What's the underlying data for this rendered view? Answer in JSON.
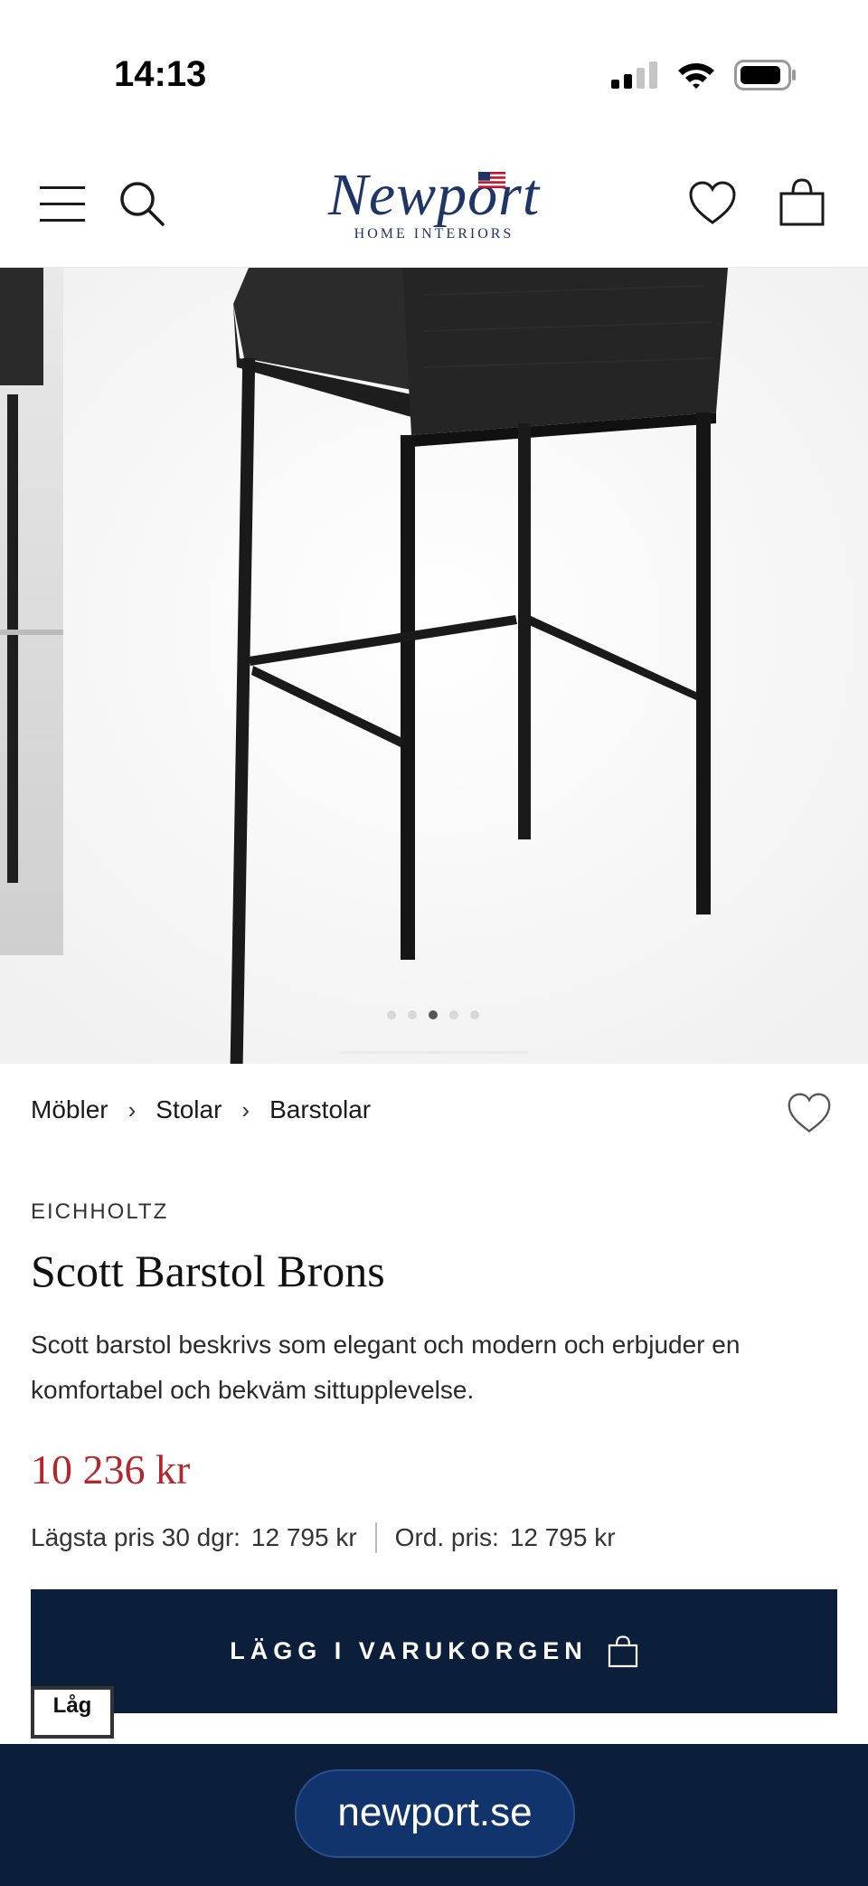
{
  "status_bar": {
    "time": "14:13"
  },
  "header": {
    "logo_word": "Newport",
    "logo_sub": "HOME INTERIORS"
  },
  "gallery": {
    "slide_count": 5,
    "active_index": 2
  },
  "breadcrumb": [
    "Möbler",
    "Stolar",
    "Barstolar"
  ],
  "breadcrumb_separator": "›",
  "product": {
    "brand": "EICHHOLTZ",
    "title": "Scott Barstol Brons",
    "description": "Scott barstol beskrivs som elegant och modern och erbjuder en komfortabel och bekväm sittupplevelse.",
    "price": "10 236 kr",
    "lowest_price_label": "Lägsta pris 30 dgr:",
    "lowest_price_value": "12 795 kr",
    "ordinary_price_label": "Ord. pris:",
    "ordinary_price_value": "12 795 kr"
  },
  "cta": {
    "add_to_cart_label": "LÄGG I VARUKORGEN"
  },
  "badge": {
    "low_stock": "Låg"
  },
  "browser": {
    "url": "newport.se"
  },
  "colors": {
    "navy": "#0b1e3a",
    "price_red": "#b3262b",
    "logo_blue": "#1f3566"
  }
}
